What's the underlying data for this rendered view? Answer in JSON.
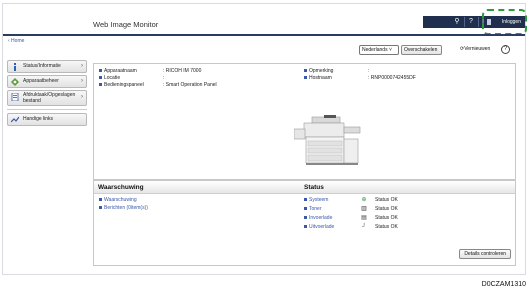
{
  "header": {
    "app_title": "Web Image Monitor",
    "search_icon": "⚲",
    "help_icon": "?",
    "info_icon": "i",
    "login_label": "Inloggen"
  },
  "breadcrumb": "‹ Home",
  "sidebar": {
    "items": [
      {
        "label": "Status/Informatie",
        "icon": "info-icon"
      },
      {
        "label": "Apparaatbeheer",
        "icon": "device-management-icon"
      },
      {
        "label_line1": "Afdruktaak/Opgeslagen",
        "label_line2": "bestand",
        "icon": "print-job-icon"
      },
      {
        "label": "Handige links",
        "icon": "links-icon"
      }
    ]
  },
  "controls": {
    "language": "Nederlands",
    "switch_label": "Overschakelen",
    "refresh_label": "Vernieuwen",
    "help_label": "?"
  },
  "device_info": {
    "model_label": "Apparaatnaam",
    "model_value": ": RICOH IM 7000",
    "location_label": "Locatie",
    "location_value": ":",
    "panel_label": "Bedieningspaneel",
    "panel_value": ": Smart Operation Panel",
    "comment_label": "Opmerking",
    "comment_value": ":",
    "host_label": "Hostnaam",
    "host_value": ": RNP0000742455DF"
  },
  "warning": {
    "title": "Waarschuwing",
    "links": [
      "Waarschuwing",
      "Berichten (0item(s))"
    ]
  },
  "status": {
    "title": "Status",
    "rows": [
      {
        "label": "Systeem",
        "value": "Status OK",
        "icon": "system-ok-icon"
      },
      {
        "label": "Toner",
        "value": "Status OK",
        "icon": "toner-icon"
      },
      {
        "label": "Invoerlade",
        "value": "Status OK",
        "icon": "input-tray-icon"
      },
      {
        "label": "Uitvoerlade",
        "value": "Status OK",
        "icon": "output-tray-icon"
      }
    ],
    "details_button": "Details controleren"
  },
  "figure_code": "D0CZAM1310",
  "colors": {
    "header_strip": "#1f2f4d",
    "link_blue": "#3a57a8",
    "highlight_green": "#2e9a3c"
  }
}
